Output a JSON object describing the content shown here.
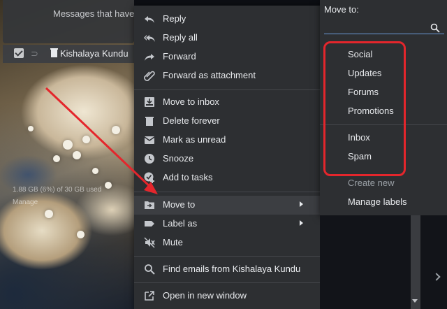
{
  "background": {
    "notice_text": "Messages that have be",
    "sender": "Kishalaya Kundu",
    "storage": "1.88 GB (6%) of 30 GB used",
    "manage": "Manage"
  },
  "context_menu": {
    "items": [
      {
        "label": "Reply",
        "icon": "reply-icon"
      },
      {
        "label": "Reply all",
        "icon": "reply-all-icon"
      },
      {
        "label": "Forward",
        "icon": "forward-icon"
      },
      {
        "label": "Forward as attachment",
        "icon": "attachment-icon"
      },
      {
        "label": "Move to inbox",
        "icon": "inbox-icon"
      },
      {
        "label": "Delete forever",
        "icon": "trash-icon"
      },
      {
        "label": "Mark as unread",
        "icon": "mail-icon"
      },
      {
        "label": "Snooze",
        "icon": "clock-icon"
      },
      {
        "label": "Add to tasks",
        "icon": "task-add-icon"
      },
      {
        "label": "Move to",
        "icon": "folder-move-icon"
      },
      {
        "label": "Label as",
        "icon": "label-icon"
      },
      {
        "label": "Mute",
        "icon": "mute-icon"
      },
      {
        "label": "Find emails from Kishalaya Kundu",
        "icon": "search-icon"
      },
      {
        "label": "Open in new window",
        "icon": "open-external-icon"
      }
    ]
  },
  "submenu": {
    "title": "Move to:",
    "search_placeholder": "",
    "items": [
      "Social",
      "Updates",
      "Forums",
      "Promotions",
      "Inbox",
      "Spam",
      "Create new",
      "Manage labels"
    ]
  },
  "colors": {
    "menu_bg": "#2d2f32",
    "highlight_red": "#e4262c",
    "accent_blue": "#6b9bd8"
  }
}
